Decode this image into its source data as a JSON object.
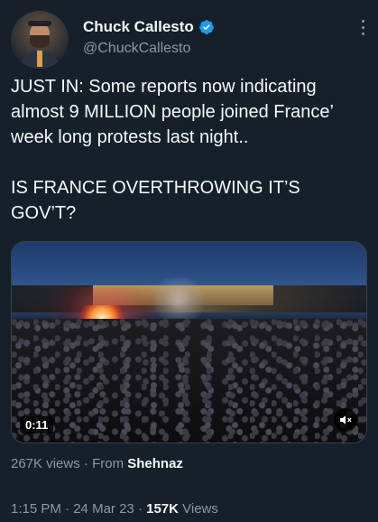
{
  "author": {
    "name": "Chuck Callesto",
    "handle": "@ChuckCallesto",
    "verified_color": "#1d9bf0"
  },
  "tweet": {
    "text": "JUST IN: Some reports now indicating almost 9 MILLION people joined France’ week long protests last night..\n\nIS FRANCE OVERTHROWING IT’S GOV’T?"
  },
  "media": {
    "duration": "0:11",
    "mute_icon": "speaker-muted-icon"
  },
  "video_stats": {
    "views": "267K views",
    "separator": "·",
    "from_label": "From",
    "from_name": "Shehnaz"
  },
  "meta": {
    "time": "1:15 PM",
    "date": "24 Mar 23",
    "separator": "·",
    "views_count": "157K",
    "views_label": "Views"
  }
}
